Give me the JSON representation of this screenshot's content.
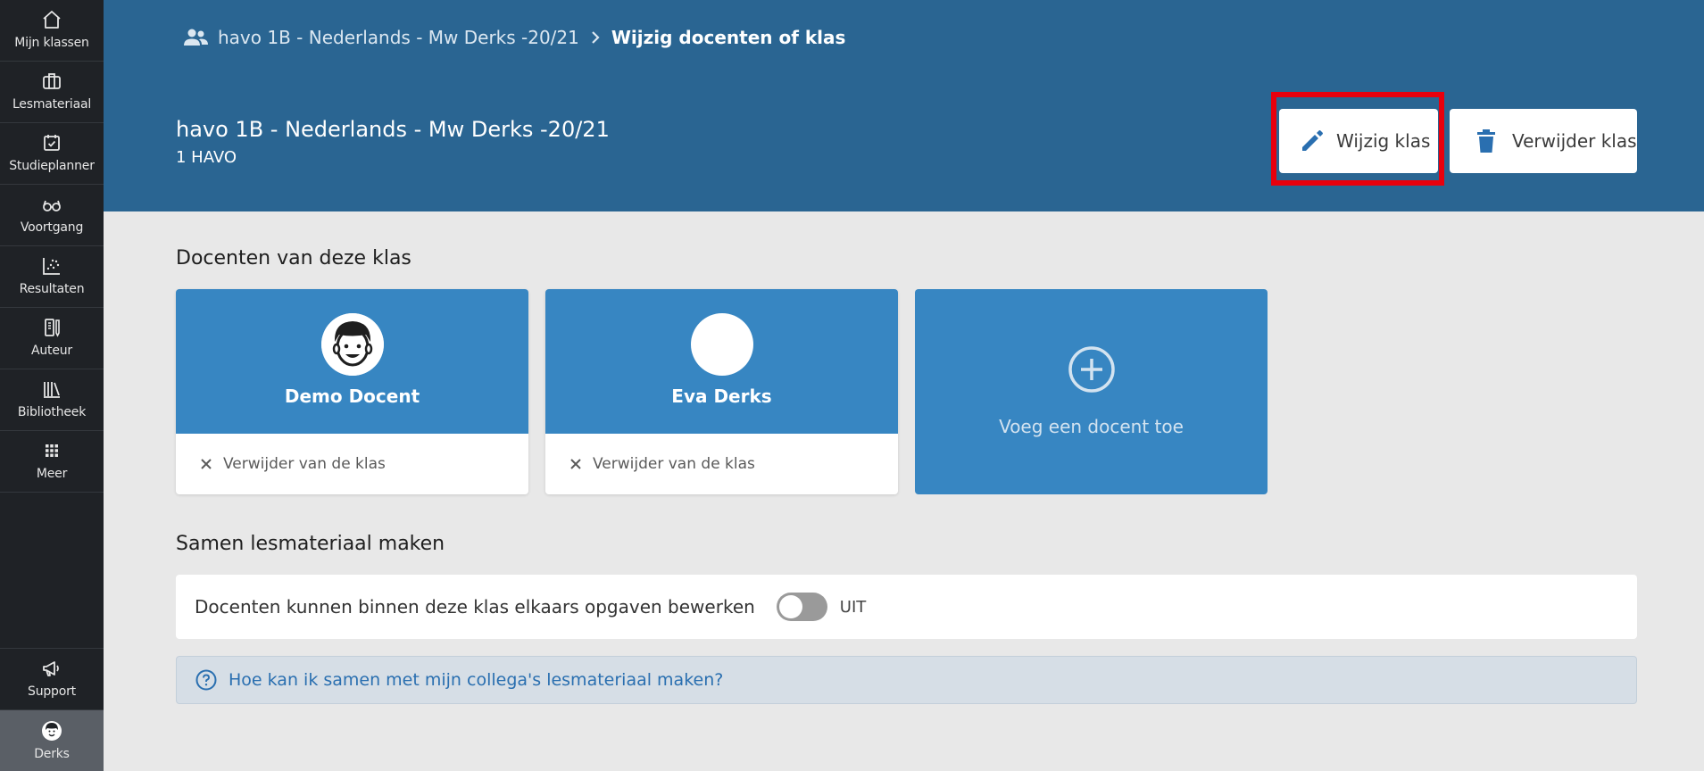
{
  "sidebar": {
    "items": [
      {
        "label": "Mijn klassen",
        "icon": "home-icon"
      },
      {
        "label": "Lesmateriaal",
        "icon": "briefcase-icon"
      },
      {
        "label": "Studieplanner",
        "icon": "calendar-check-icon"
      },
      {
        "label": "Voortgang",
        "icon": "glasses-icon"
      },
      {
        "label": "Resultaten",
        "icon": "scatter-chart-icon"
      },
      {
        "label": "Auteur",
        "icon": "author-icon"
      },
      {
        "label": "Bibliotheek",
        "icon": "library-icon"
      },
      {
        "label": "Meer",
        "icon": "grid-icon"
      }
    ],
    "support_label": "Support",
    "user_label": "Derks"
  },
  "breadcrumb": {
    "class_link": "havo 1B - Nederlands - Mw Derks -20/21",
    "current": "Wijzig docenten of klas"
  },
  "header": {
    "title": "havo 1B - Nederlands - Mw Derks -20/21",
    "subtitle": "1 HAVO",
    "edit_label": "Wijzig klas",
    "delete_label": "Verwijder klas"
  },
  "teachers": {
    "section_title": "Docenten van deze klas",
    "cards": [
      {
        "name": "Demo Docent",
        "remove_label": "Verwijder van de klas"
      },
      {
        "name": "Eva Derks",
        "remove_label": "Verwijder van de klas"
      }
    ],
    "add_label": "Voeg een docent toe"
  },
  "collab": {
    "section_title": "Samen lesmateriaal maken",
    "toggle_label": "Docenten kunnen binnen deze klas elkaars opgaven bewerken",
    "toggle_state": "UIT",
    "toggle_on": false,
    "help_link": "Hoe kan ik samen met mijn collega's lesmateriaal maken?"
  },
  "colors": {
    "sidebar_bg": "#1f2226",
    "header_bg": "#2a6592",
    "card_blue": "#3786c2",
    "highlight": "#e8000d"
  }
}
